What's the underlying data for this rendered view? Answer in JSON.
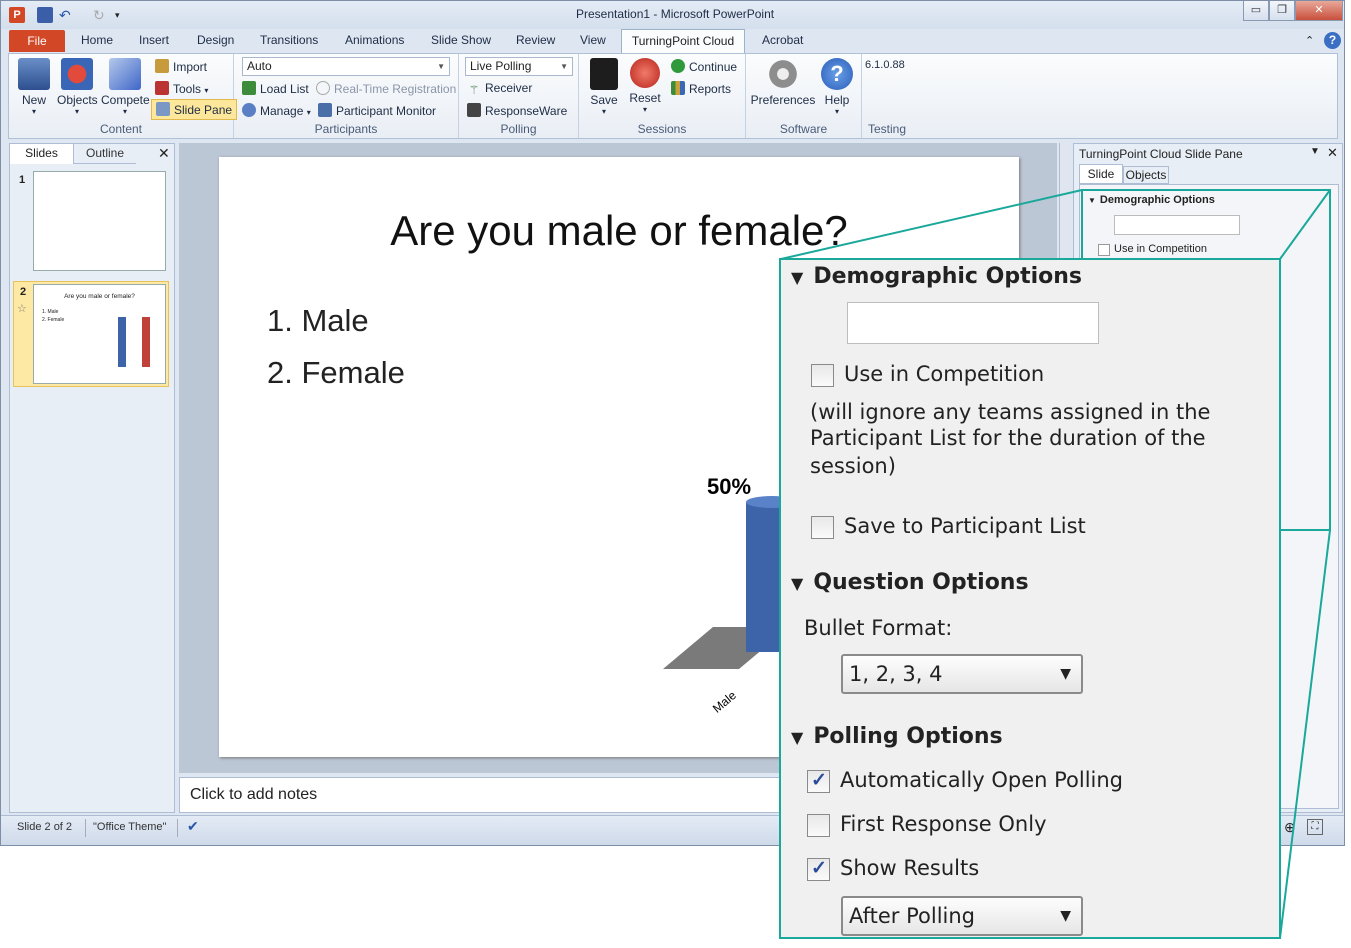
{
  "window": {
    "title": "Presentation1 - Microsoft PowerPoint"
  },
  "tabs": {
    "file": "File",
    "items": [
      "Home",
      "Insert",
      "Design",
      "Transitions",
      "Animations",
      "Slide Show",
      "Review",
      "View"
    ],
    "active": "TurningPoint Cloud",
    "acrobat": "Acrobat"
  },
  "ribbon": {
    "content": {
      "label": "Content",
      "new": "New",
      "objects": "Objects",
      "compete": "Compete",
      "import": "Import",
      "tools": "Tools",
      "slide_pane": "Slide Pane"
    },
    "participants": {
      "label": "Participants",
      "dropdown": "Auto",
      "load_list": "Load List",
      "realtime": "Real-Time Registration",
      "manage": "Manage",
      "monitor": "Participant Monitor"
    },
    "polling": {
      "label": "Polling",
      "dropdown": "Live Polling",
      "receiver": "Receiver",
      "responseware": "ResponseWare"
    },
    "sessions": {
      "label": "Sessions",
      "save": "Save",
      "reset": "Reset",
      "continue": "Continue",
      "reports": "Reports"
    },
    "software": {
      "label": "Software",
      "preferences": "Preferences",
      "help": "Help"
    },
    "testing": {
      "label": "Testing",
      "version": "6.1.0.88"
    }
  },
  "leftpane": {
    "tab_slides": "Slides",
    "tab_outline": "Outline",
    "slide1": "1",
    "slide2": "2",
    "thumb_title": "Are you male or female?",
    "thumb_items": [
      "1. Male",
      "2. Female"
    ]
  },
  "slide": {
    "title": "Are you male or female?",
    "items": [
      "1.  Male",
      "2.  Female"
    ],
    "percent": "50%",
    "category": "Male"
  },
  "chart_data": {
    "type": "bar",
    "categories": [
      "Male",
      "Female"
    ],
    "values": [
      50,
      50
    ],
    "title": "",
    "ylim": [
      0,
      100
    ]
  },
  "notes": "Click to add notes",
  "taskpane": {
    "title": "TurningPoint Cloud Slide Pane",
    "tab_slide": "Slide",
    "tab_objects": "Objects",
    "section": "Demographic Options",
    "use_competition": "Use in Competition"
  },
  "status": {
    "slide": "Slide 2 of 2",
    "theme": "\"Office Theme\""
  },
  "zoom": {
    "demographic_heading": "Demographic Options",
    "use_competition": "Use in Competition",
    "note_lines": [
      "(will ignore any teams assigned in the",
      "Participant List for the duration of the",
      "session)"
    ],
    "save_participant": "Save to Participant List",
    "question_heading": "Question Options",
    "bullet_format_label": "Bullet Format:",
    "bullet_format_value": "1, 2, 3, 4",
    "polling_heading": "Polling Options",
    "auto_open": "Automatically Open Polling",
    "first_response": "First Response Only",
    "show_results": "Show Results",
    "show_results_value": "After Polling"
  }
}
